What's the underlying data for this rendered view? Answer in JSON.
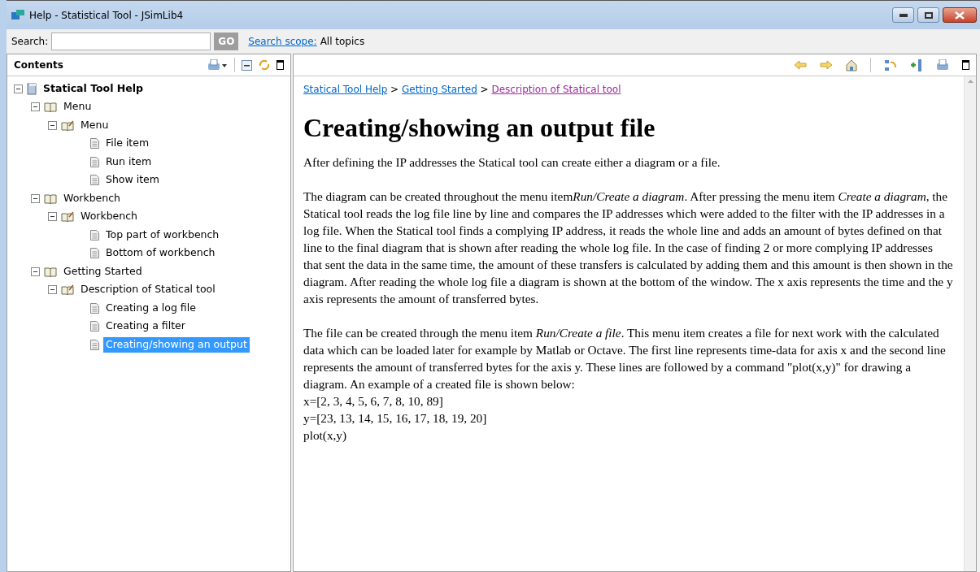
{
  "window": {
    "title": "Help - Statistical Tool - JSimLib4"
  },
  "search": {
    "label": "Search:",
    "button": "GO",
    "scope_link": "Search scope:",
    "scope_value": "All topics"
  },
  "contents": {
    "title": "Contents",
    "tree": [
      {
        "label": "Statical Tool Help",
        "kind": "root",
        "expanded": true,
        "selected": false,
        "children": [
          {
            "label": "Menu",
            "kind": "book",
            "expanded": true,
            "selected": false,
            "children": [
              {
                "label": "Menu",
                "kind": "chapter",
                "expanded": true,
                "selected": false,
                "children": [
                  {
                    "label": "File item",
                    "kind": "topic",
                    "selected": false
                  },
                  {
                    "label": "Run item",
                    "kind": "topic",
                    "selected": false
                  },
                  {
                    "label": "Show item",
                    "kind": "topic",
                    "selected": false
                  }
                ]
              }
            ]
          },
          {
            "label": "Workbench",
            "kind": "book",
            "expanded": true,
            "selected": false,
            "children": [
              {
                "label": "Workbench",
                "kind": "chapter",
                "expanded": true,
                "selected": false,
                "children": [
                  {
                    "label": "Top part of workbench",
                    "kind": "topic",
                    "selected": false
                  },
                  {
                    "label": "Bottom of workbench",
                    "kind": "topic",
                    "selected": false
                  }
                ]
              }
            ]
          },
          {
            "label": "Getting Started",
            "kind": "book",
            "expanded": true,
            "selected": false,
            "children": [
              {
                "label": "Description of Statical tool",
                "kind": "chapter",
                "expanded": true,
                "selected": false,
                "children": [
                  {
                    "label": "Creating a log file",
                    "kind": "topic",
                    "selected": false
                  },
                  {
                    "label": "Creating a filter",
                    "kind": "topic",
                    "selected": false
                  },
                  {
                    "label": "Creating/showing an output",
                    "kind": "topic",
                    "selected": true
                  }
                ]
              }
            ]
          }
        ]
      }
    ]
  },
  "document": {
    "breadcrumbs": [
      {
        "label": "Statical Tool Help",
        "visited": false
      },
      {
        "label": "Getting Started",
        "visited": false
      },
      {
        "label": "Description of Statical tool",
        "visited": true
      }
    ],
    "separator": ">",
    "heading": "Creating/showing an output file",
    "paragraphs": [
      {
        "kind": "text",
        "lines": [
          "After defining the IP addresses the Statical tool can create either a diagram or a file."
        ]
      },
      {
        "kind": "runs",
        "runs": [
          {
            "text": "The diagram can be created throughout the menu item",
            "italic": false
          },
          {
            "text": "Run/Create a diagram",
            "italic": true
          },
          {
            "text": ". After pressing the menu item ",
            "italic": false
          },
          {
            "text": "Create a diagram",
            "italic": true
          },
          {
            "text": ", the Statical tool reads the log file line by line and compares the IP addresses which were added to the filter with the IP addresses in a log file. When the Statical tool finds a complying IP address, it reads the whole line and adds an amount of bytes defined on that line to the final diagram that is shown after reading the whole log file. In the case of finding 2 or more complying IP addresses that sent the data in the same time, the amount of these transfers is calculated by adding them and this amount is then shown in the diagram. After reading the whole log file a diagram is shown at the bottom of the window. The x axis represents the time and the y axis represents the amount of transferred bytes.",
            "italic": false
          }
        ]
      },
      {
        "kind": "text",
        "lines": [
          "The file can be created through the menu item *Run/Create a file*. This menu item creates a file for next work with the calculated data which can be loaded later for example by Matlab or Octave. The first line represents time-data for axis x and the second line represents the amount of transferred bytes for the axis y. These lines are followed by a command \"plot(x,y)\" for drawing a diagram. An example of a created file is shown below:",
          "x=[2, 3, 4, 5, 6, 7, 8, 10, 89]",
          "y=[23, 13, 14, 15, 16, 17, 18, 19, 20]",
          "plot(x,y)"
        ]
      }
    ]
  }
}
